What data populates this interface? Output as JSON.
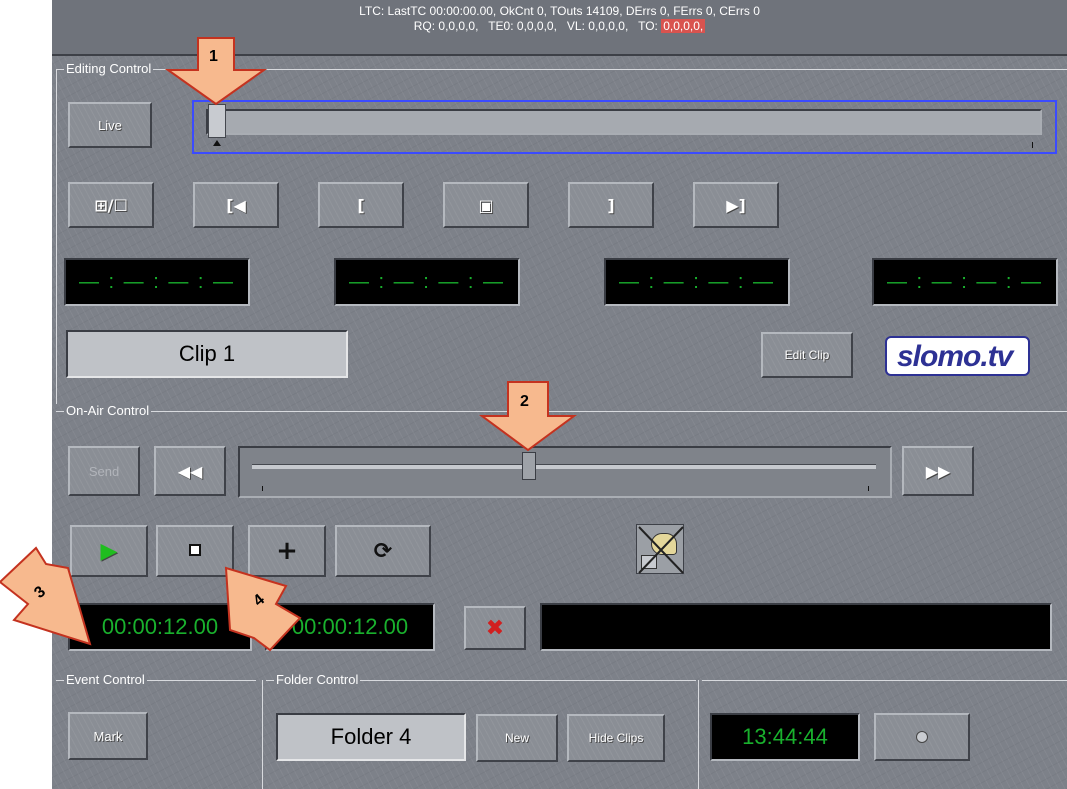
{
  "status": {
    "line1": "LTC: LastTC 00:00:00.00, OkCnt 0, TOuts 14109, DErrs 0, FErrs 0, CErrs 0",
    "line2_prefix": "RQ: 0,0,0,0,   TE0: 0,0,0,0,   VL: 0,0,0,0,   TO:",
    "line2_alert": "0,0,0,0,",
    "alert_color": "#d9534f"
  },
  "editing": {
    "group_label": "Editing Control",
    "live_label": "Live",
    "transport_buttons": [
      {
        "name": "split-view-icon",
        "glyph": "⊞/☐"
      },
      {
        "name": "go-to-in-icon",
        "glyph": "[◀"
      },
      {
        "name": "mark-in-icon",
        "glyph": "["
      },
      {
        "name": "clip-frame-icon",
        "glyph": "▣"
      },
      {
        "name": "mark-out-icon",
        "glyph": "]"
      },
      {
        "name": "go-to-out-icon",
        "glyph": "▶]"
      }
    ],
    "timecodes": [
      "— : — : — : —",
      "— : — : — : —",
      "— : — : — : —",
      "— : — : — : —"
    ],
    "clip_name": "Clip 1",
    "edit_clip_label": "Edit Clip",
    "logo_text": "slomo.tv"
  },
  "on_air": {
    "group_label": "On-Air Control",
    "send_label": "Send",
    "rewind_glyph": "◀◀",
    "forward_glyph": "▶▶",
    "play_glyph": "▶",
    "stop_glyph": "■",
    "add_glyph": "+",
    "loop_glyph": "⟳",
    "timecode_in": "00:00:12.00",
    "timecode_out": "00:00:12.00",
    "clear_glyph": "✖",
    "play_color": "#1fbd1f",
    "clear_color": "#d11f1f"
  },
  "event": {
    "group_label": "Event Control",
    "mark_label": "Mark"
  },
  "folder": {
    "group_label": "Folder Control",
    "folder_name": "Folder 4",
    "new_label": "New",
    "hide_clips_label": "Hide Clips"
  },
  "clock": {
    "time": "13:44:44"
  },
  "callouts": [
    "1",
    "2",
    "3",
    "4"
  ]
}
